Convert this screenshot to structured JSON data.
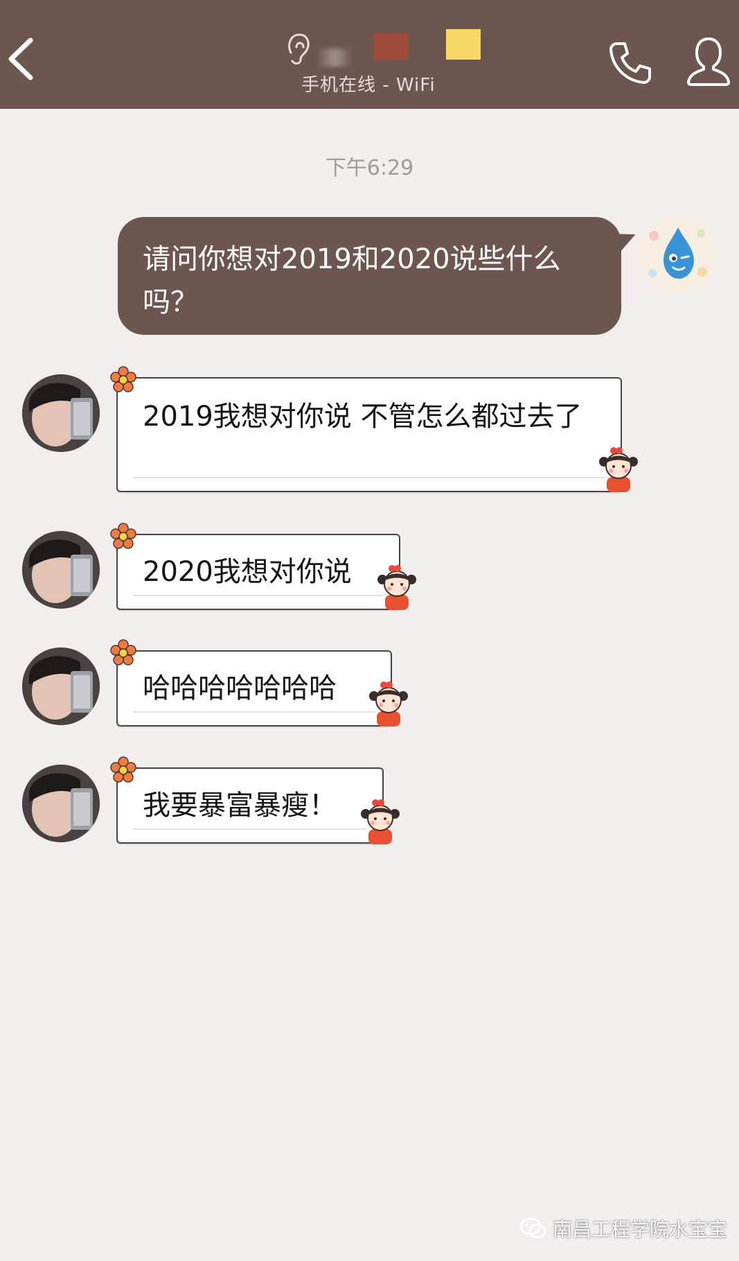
{
  "header": {
    "status": "手机在线 - WiFi",
    "bar_color": "#6d5550",
    "icons": [
      "back-icon",
      "ear-icon",
      "phone-icon",
      "profile-icon"
    ]
  },
  "timestamp": "下午6:29",
  "messages": [
    {
      "direction": "outgoing",
      "text": "请问你想对2019和2020说些什么吗？"
    },
    {
      "direction": "incoming",
      "text": "2019我想对你说 不管怎么都过去了"
    },
    {
      "direction": "incoming",
      "text": "2020我想对你说"
    },
    {
      "direction": "incoming",
      "text": "哈哈哈哈哈哈哈"
    },
    {
      "direction": "incoming",
      "text": "我要暴富暴瘦！"
    }
  ],
  "watermark": {
    "text": "南昌工程学院水宝宝",
    "icon": "wechat-icon"
  },
  "colors": {
    "outgoing_bubble": "#6d5550",
    "incoming_bubble": "#ffffff",
    "background": "#f1eeed"
  }
}
